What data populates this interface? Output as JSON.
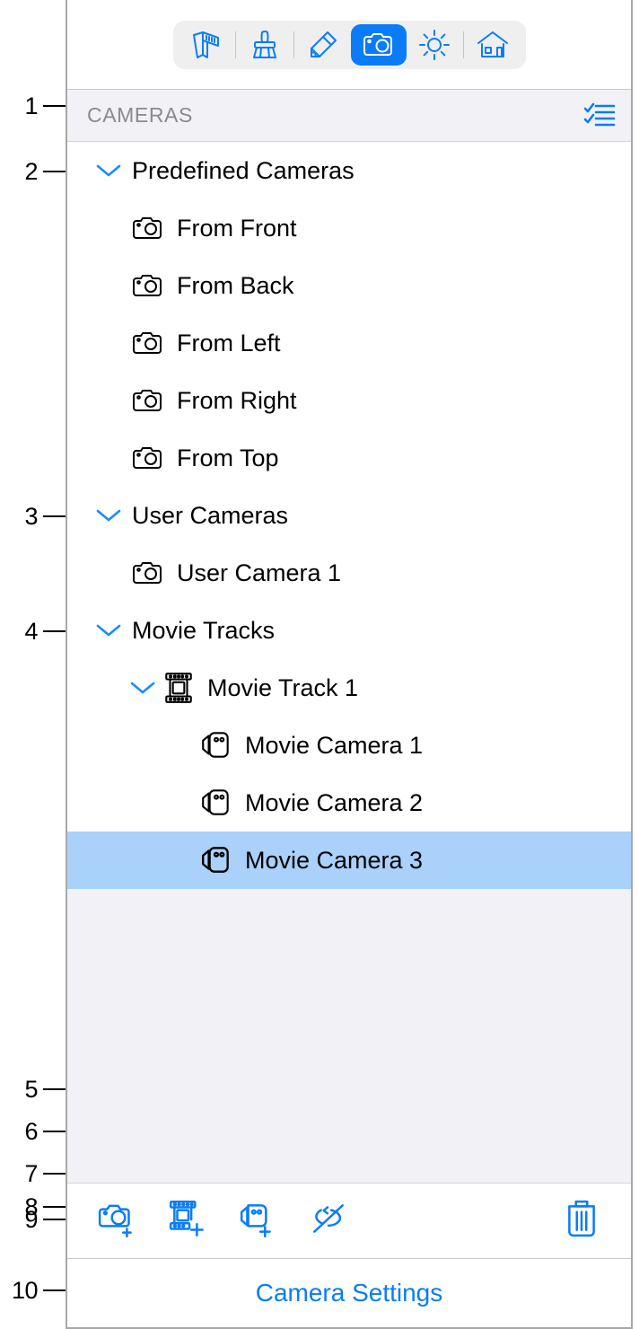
{
  "callouts": [
    {
      "num": "1"
    },
    {
      "num": "2"
    },
    {
      "num": "3"
    },
    {
      "num": "4"
    },
    {
      "num": "5"
    },
    {
      "num": "6"
    },
    {
      "num": "7"
    },
    {
      "num": "8"
    },
    {
      "num": "9"
    },
    {
      "num": "10"
    }
  ],
  "toolbar": {
    "items": [
      {
        "icon": "measure-caliper-icon",
        "label": "Measure",
        "active": false
      },
      {
        "icon": "brush-icon",
        "label": "Paint",
        "active": false
      },
      {
        "icon": "eraser-pencil-icon",
        "label": "Markup",
        "active": false
      },
      {
        "icon": "camera-icon",
        "label": "Cameras",
        "active": true
      },
      {
        "icon": "sun-icon",
        "label": "Lighting",
        "active": false
      },
      {
        "icon": "house-icon",
        "label": "Site",
        "active": false
      }
    ]
  },
  "section": {
    "title": "CAMERAS",
    "action_icon": "checklist-icon"
  },
  "tree": {
    "rows": [
      {
        "label": "Predefined Cameras",
        "indent": 0,
        "twisty": "chevron-down-icon",
        "icon": null,
        "selected": false
      },
      {
        "label": "From Front",
        "indent": 1,
        "twisty": null,
        "icon": "camera-icon",
        "selected": false
      },
      {
        "label": "From Back",
        "indent": 1,
        "twisty": null,
        "icon": "camera-icon",
        "selected": false
      },
      {
        "label": "From Left",
        "indent": 1,
        "twisty": null,
        "icon": "camera-icon",
        "selected": false
      },
      {
        "label": "From Right",
        "indent": 1,
        "twisty": null,
        "icon": "camera-icon",
        "selected": false
      },
      {
        "label": "From Top",
        "indent": 1,
        "twisty": null,
        "icon": "camera-icon",
        "selected": false
      },
      {
        "label": "User Cameras",
        "indent": 0,
        "twisty": "chevron-down-icon",
        "icon": null,
        "selected": false
      },
      {
        "label": "User Camera 1",
        "indent": 1,
        "twisty": null,
        "icon": "camera-icon",
        "selected": false
      },
      {
        "label": "Movie Tracks",
        "indent": 0,
        "twisty": "chevron-down-icon",
        "icon": null,
        "selected": false
      },
      {
        "label": "Movie Track 1",
        "indent": 2,
        "twisty": "chevron-down-icon",
        "icon": "film-reel-icon",
        "selected": false
      },
      {
        "label": "Movie Camera 1",
        "indent": 3,
        "twisty": null,
        "icon": "movie-camera-icon",
        "selected": false
      },
      {
        "label": "Movie Camera 2",
        "indent": 3,
        "twisty": null,
        "icon": "movie-camera-icon",
        "selected": false
      },
      {
        "label": "Movie Camera 3",
        "indent": 3,
        "twisty": null,
        "icon": "movie-camera-icon",
        "selected": true
      }
    ]
  },
  "bottom_bar": {
    "items": [
      {
        "icon": "add-camera-icon",
        "label": "Add Camera"
      },
      {
        "icon": "add-movie-track-icon",
        "label": "Add Movie Track"
      },
      {
        "icon": "add-movie-camera-icon",
        "label": "Add Movie Camera"
      },
      {
        "icon": "loop-disabled-icon",
        "label": "Disable Loop"
      },
      {
        "icon": "trash-icon",
        "label": "Delete"
      }
    ]
  },
  "footer": {
    "link_label": "Camera Settings"
  },
  "colors": {
    "accent": "#0a7cf8",
    "selection": "#a9d1fa",
    "panel_bg": "#ffffff",
    "header_bg": "#f2f1f5",
    "header_text": "#8a8a8e",
    "row_text": "#000000",
    "border": "#a8a8a8"
  }
}
